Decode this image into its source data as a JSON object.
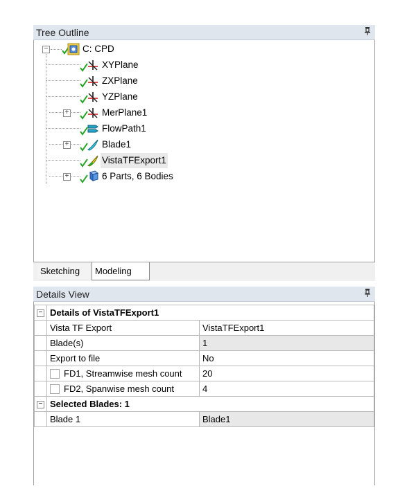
{
  "tree_outline": {
    "title": "Tree Outline",
    "pin_icon": "pin-icon",
    "nodes": [
      {
        "label": "C: CPD",
        "icon": "root-cube-icon"
      },
      {
        "label": "XYPlane",
        "icon": "plane-axes-icon"
      },
      {
        "label": "ZXPlane",
        "icon": "plane-axes-icon"
      },
      {
        "label": "YZPlane",
        "icon": "plane-axes-icon"
      },
      {
        "label": "MerPlane1",
        "icon": "plane-axes-icon"
      },
      {
        "label": "FlowPath1",
        "icon": "flowpath-icon"
      },
      {
        "label": "Blade1",
        "icon": "blade-icon"
      },
      {
        "label": "VistaTFExport1",
        "icon": "export-icon"
      },
      {
        "label": "6 Parts, 6 Bodies",
        "icon": "parts-cubes-icon"
      }
    ],
    "expander_minus": "−",
    "expander_plus": "+"
  },
  "tabs": [
    {
      "label": "Sketching"
    },
    {
      "label": "Modeling",
      "selected": true
    }
  ],
  "details_view": {
    "title": "Details View",
    "groups": [
      {
        "header": "Details of VistaTFExport1",
        "rows": [
          {
            "name": "Vista TF Export",
            "value": "VistaTFExport1"
          },
          {
            "name": "Blade(s)",
            "value": "1"
          },
          {
            "name": "Export to file",
            "value": "No"
          },
          {
            "name": "FD1,  Streamwise mesh count",
            "value": "20"
          },
          {
            "name": "FD2,  Spanwise mesh count",
            "value": "4"
          }
        ]
      },
      {
        "header": "Selected Blades: 1",
        "rows": [
          {
            "name": "Blade 1",
            "value": "Blade1"
          }
        ]
      }
    ],
    "expander_minus": "−"
  },
  "colors": {
    "check_green": "#2aa52a",
    "header_bg": "#dfe6ee",
    "selected_row": "#e9e9e9"
  }
}
